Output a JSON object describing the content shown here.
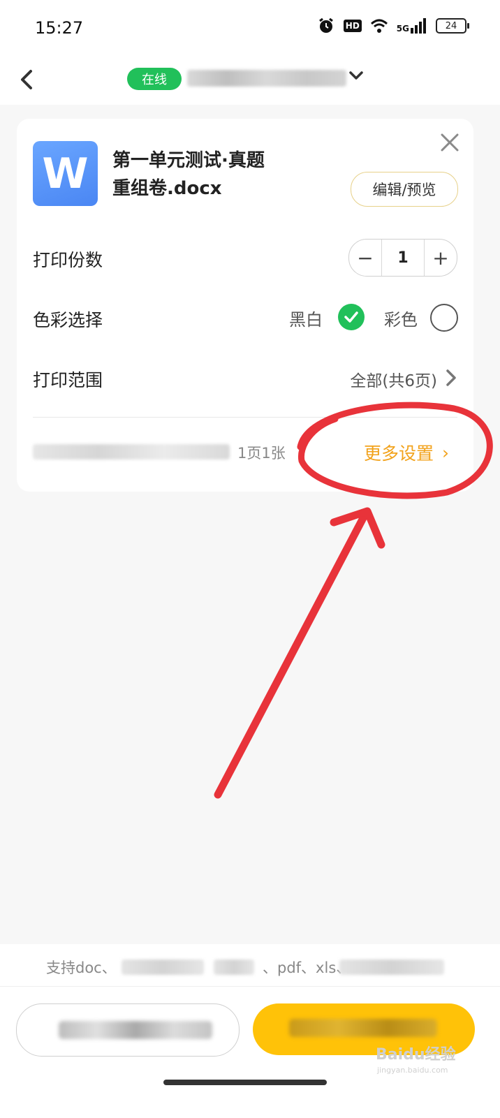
{
  "status_bar": {
    "time": "15:27",
    "network_label": "5G",
    "battery_level": "24"
  },
  "header": {
    "online_badge": "在线"
  },
  "file": {
    "icon_letter": "W",
    "name_line1": "第一单元测试·真题",
    "name_line2": "重组卷.docx",
    "edit_label": "编辑/预览"
  },
  "settings": {
    "copies_label": "打印份数",
    "copies_value": "1",
    "minus_symbol": "−",
    "plus_symbol": "+",
    "color_label": "色彩选择",
    "option_bw": "黑白",
    "option_color": "彩色",
    "selected_option": "黑白",
    "range_label": "打印范围",
    "range_value": "全部(共6页)"
  },
  "summary": {
    "page_count": "1页1张",
    "more_settings_label": "更多设置",
    "more_settings_chevron": "›"
  },
  "footer": {
    "support_prefix": "支持doc、",
    "support_mid": "、pdf、xls、"
  },
  "watermark": {
    "brand": "Baidu经验",
    "url": "jingyan.baidu.com"
  },
  "colors": {
    "accent_green": "#21c05a",
    "accent_orange": "#f2a21b",
    "primary_yellow": "#ffc208",
    "annotation_red": "#e8333a"
  }
}
